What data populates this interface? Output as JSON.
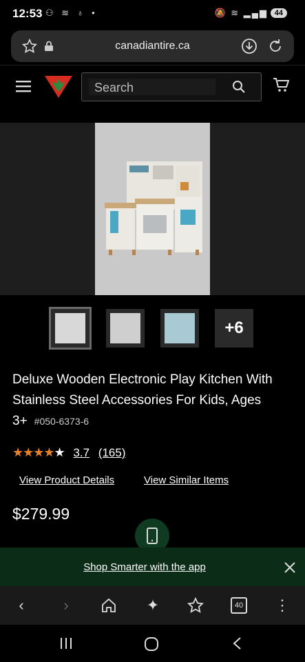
{
  "status_bar": {
    "time": "12:53",
    "left_icons": "⚇ ≋ ♁ •",
    "right_icons": "🔕 ≋ ▂▄▆",
    "battery": "44"
  },
  "browser": {
    "url": "canadiantire.ca"
  },
  "site": {
    "search_placeholder": "Search"
  },
  "product": {
    "title": "Deluxe Wooden Electronic Play Kitchen With Stainless Steel Accessories For Kids, Ages 3+",
    "sku": "#050-6373-6",
    "rating_value": "3.7",
    "rating_count": "(165)",
    "rating_fraction": 0.74,
    "price": "$279.99",
    "more_images": "+6"
  },
  "links": {
    "details": "View Product Details",
    "similar": "View Similar Items"
  },
  "promo": {
    "text": "Shop Smarter with the app",
    "close": "✕"
  },
  "toolbar_badge": "40",
  "colors": {
    "star": "#e8822a",
    "promo_bg": "#0b2d17",
    "brand_red": "#d62d20"
  }
}
